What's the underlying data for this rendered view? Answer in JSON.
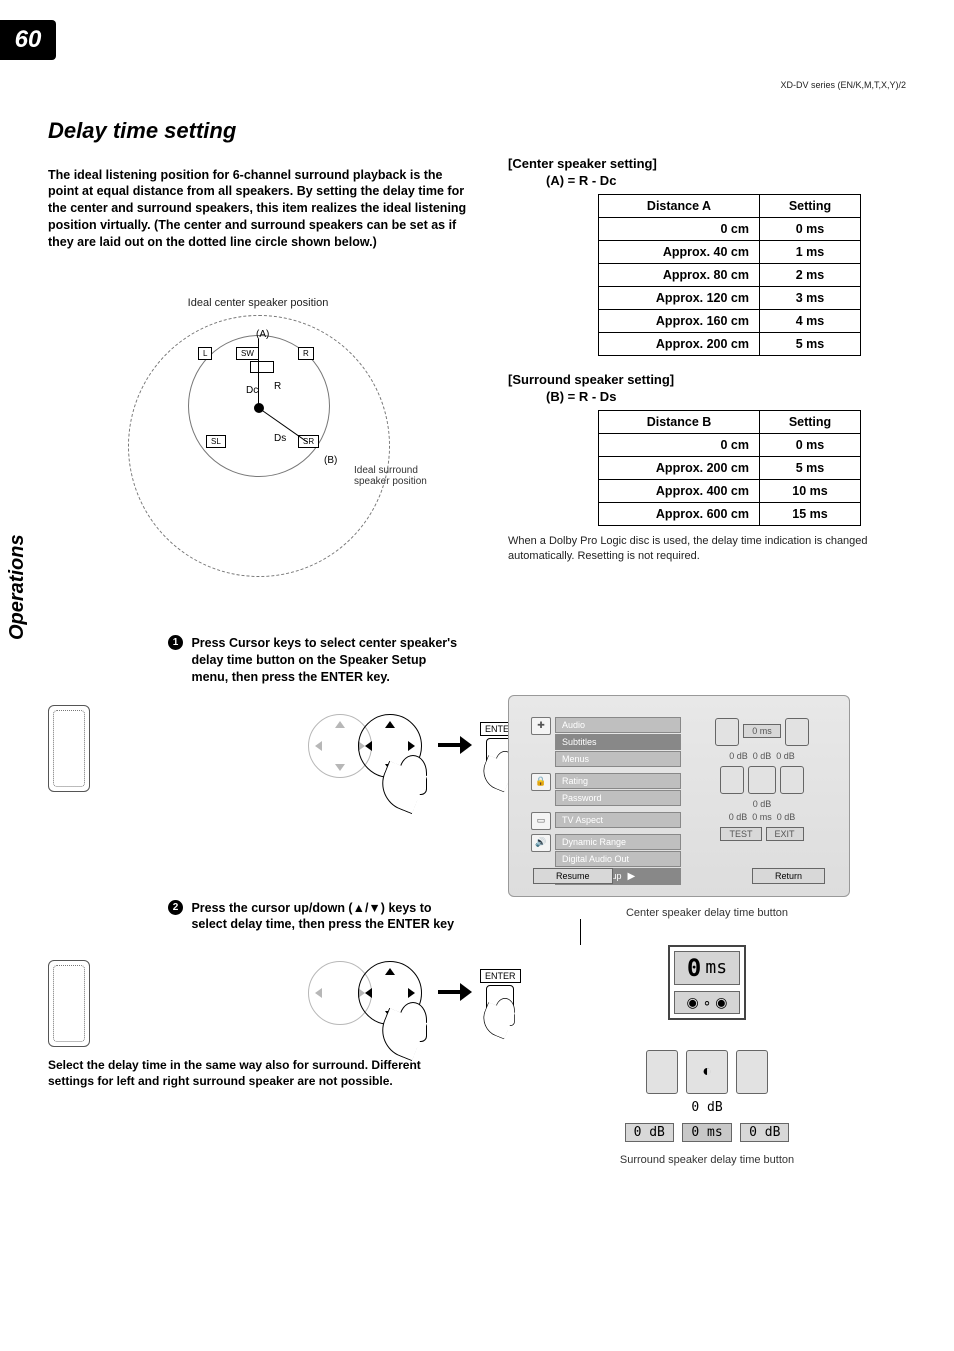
{
  "pageNumber": "60",
  "headerSmall": "XD-DV series (EN/K,M,T,X,Y)/2",
  "sideLabel": "Operations",
  "title": "Delay time setting",
  "intro": "The ideal listening position for 6-channel surround playback is the point at equal distance from all speakers. By setting the delay time for the center and surround speakers, this item realizes the ideal listening position virtually. (The center and surround speakers can be set as if they are laid out on the dotted line circle shown below.)",
  "diagram": {
    "topCaption": "Ideal center speaker position",
    "sideCaption": "Ideal surround speaker position",
    "labels": {
      "L": "L",
      "R": "R",
      "SW": "SW",
      "SL": "SL",
      "SR": "SR",
      "A": "(A)",
      "B": "(B)",
      "Dc": "Dc",
      "Ds": "Ds",
      "Rlabel": "R"
    }
  },
  "centerSection": {
    "heading": "[Center speaker setting]",
    "formula": "(A) = R - Dc",
    "cols": [
      "Distance A",
      "Setting"
    ],
    "rows": [
      [
        "0 cm",
        "0 ms"
      ],
      [
        "Approx.   40 cm",
        "1 ms"
      ],
      [
        "Approx.   80 cm",
        "2 ms"
      ],
      [
        "Approx. 120 cm",
        "3 ms"
      ],
      [
        "Approx. 160 cm",
        "4 ms"
      ],
      [
        "Approx. 200 cm",
        "5 ms"
      ]
    ]
  },
  "surroundSection": {
    "heading": "[Surround speaker setting]",
    "formula": "(B) = R - Ds",
    "cols": [
      "Distance B",
      "Setting"
    ],
    "rows": [
      [
        "0 cm",
        "0 ms"
      ],
      [
        "Approx. 200 cm",
        "5 ms"
      ],
      [
        "Approx. 400 cm",
        "10 ms"
      ],
      [
        "Approx. 600 cm",
        "15 ms"
      ]
    ],
    "note": "When a Dolby Pro Logic disc is used, the delay time indication is changed automatically. Resetting is not required."
  },
  "step1": {
    "num": "1",
    "text": "Press Cursor keys to select center speaker's delay time button on the Speaker Setup menu, then press the ENTER key.",
    "enterLabel": "ENTER"
  },
  "step2": {
    "num": "2",
    "text": "Press the cursor up/down (▲/▼) keys to select delay time, then press the ENTER key",
    "enterLabel": "ENTER"
  },
  "footnote": "Select the delay time in the same way also for surround. Different settings for left and right surround speaker are not possible.",
  "screenshot": {
    "menu": {
      "group1": [
        "Audio",
        "Subtitles",
        "Menus"
      ],
      "group2": [
        "Rating",
        "Password"
      ],
      "group3": [
        "TV Aspect"
      ],
      "group4": [
        "Dynamic Range",
        "Digital Audio Out",
        "Speaker Setup"
      ]
    },
    "rightTop": {
      "delay": "0 ms",
      "row2": [
        "0 dB",
        "0 dB",
        "0 dB"
      ],
      "row3mid": "0 dB",
      "row4": [
        "0 dB",
        "0 ms",
        "0 dB"
      ]
    },
    "buttons": {
      "test": "TEST",
      "exit": "EXIT"
    },
    "bottom": {
      "resume": "Resume",
      "return": "Return"
    },
    "caption": "Center speaker delay time button",
    "caption2": "Surround speaker delay time button",
    "closeup1": {
      "big": "0 ms"
    },
    "closeup2": {
      "mid": "0 dB",
      "bottom": [
        "0 dB",
        "0 ms",
        "0 dB"
      ]
    }
  }
}
